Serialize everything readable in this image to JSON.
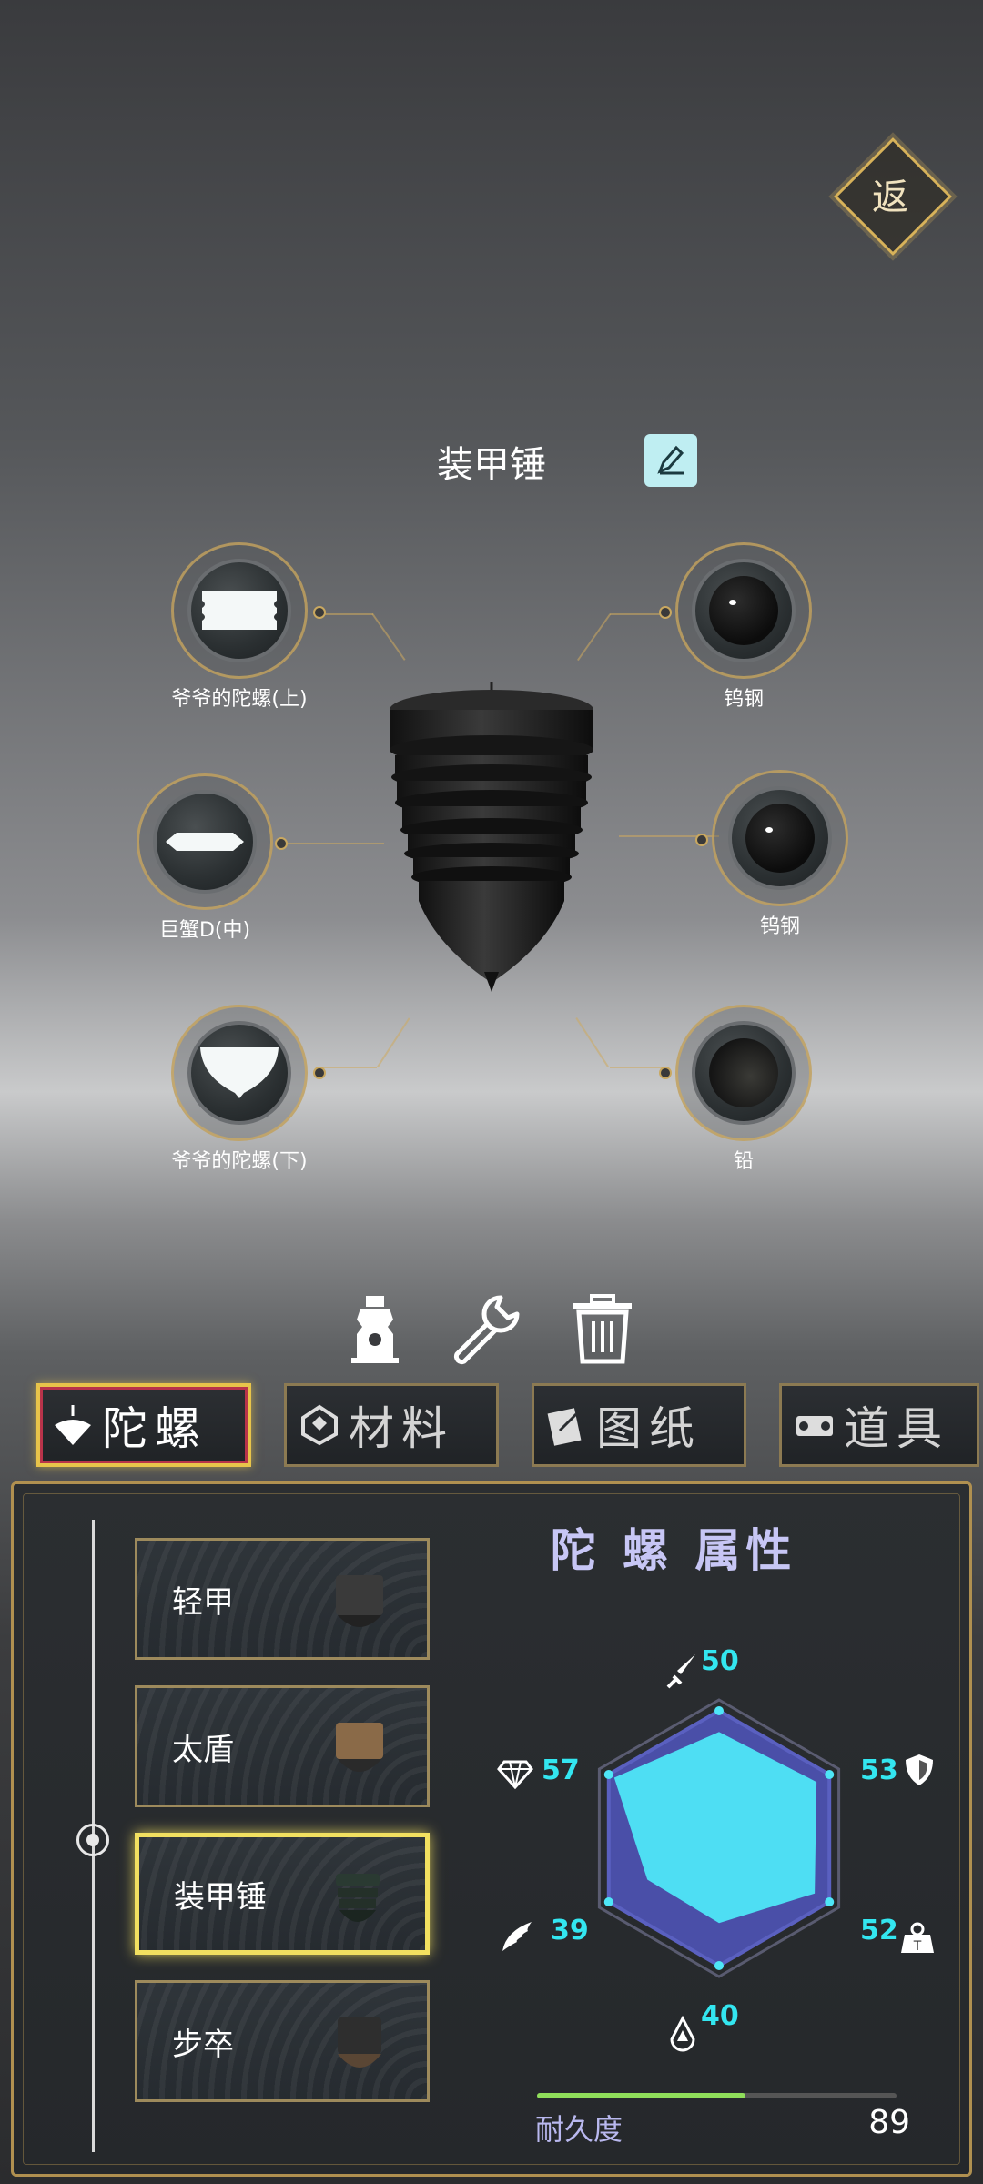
{
  "header": {
    "back_label": "返",
    "top_name": "装甲锤"
  },
  "parts": [
    {
      "label": "爷爷的陀螺(上)",
      "kind": "upper"
    },
    {
      "label": "钨钢",
      "kind": "ball"
    },
    {
      "label": "巨蟹D(中)",
      "kind": "middle"
    },
    {
      "label": "钨钢",
      "kind": "ball"
    },
    {
      "label": "爷爷的陀螺(下)",
      "kind": "lower"
    },
    {
      "label": "铅",
      "kind": "lead"
    }
  ],
  "actions": [
    "bottle-icon",
    "wrench-icon",
    "trash-icon"
  ],
  "tabs": [
    {
      "label": "陀螺",
      "icon": "spinning-top-icon",
      "active": true
    },
    {
      "label": "材料",
      "icon": "material-icon",
      "active": false
    },
    {
      "label": "图纸",
      "icon": "blueprint-icon",
      "active": false
    },
    {
      "label": "道具",
      "icon": "item-icon",
      "active": false
    }
  ],
  "list": [
    {
      "label": "轻甲",
      "selected": false
    },
    {
      "label": "太盾",
      "selected": false
    },
    {
      "label": "装甲锤",
      "selected": true
    },
    {
      "label": "步卒",
      "selected": false
    }
  ],
  "stats": {
    "title": "陀 螺 属性",
    "attack": 50,
    "defense": 53,
    "weight": 52,
    "balance": 40,
    "speed": 39,
    "rarity": 57,
    "max": 60,
    "fill_color": "#4ee6f7",
    "frame_color": "#4a4fa8"
  },
  "durability": {
    "label": "耐久度",
    "value": 89,
    "fill_fraction": 0.58
  }
}
